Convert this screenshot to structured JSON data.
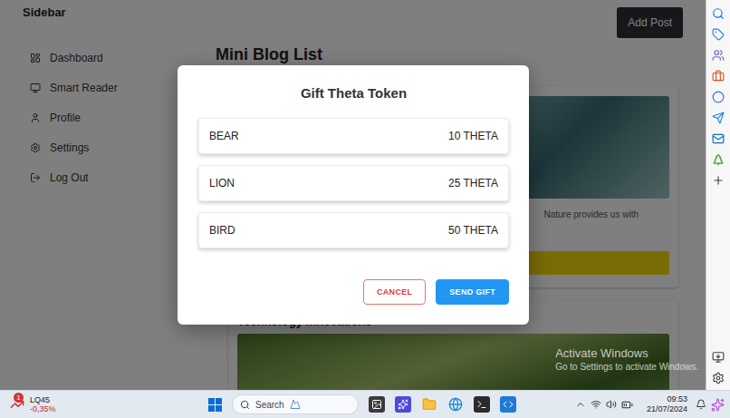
{
  "page": {
    "sidebar": {
      "title": "Sidebar",
      "items": [
        {
          "label": "Dashboard"
        },
        {
          "label": "Smart Reader"
        },
        {
          "label": "Profile"
        },
        {
          "label": "Settings"
        },
        {
          "label": "Log Out"
        }
      ]
    },
    "add_button": "Add Post",
    "heading": "Mini Blog List",
    "posts": [
      {
        "excerpt": "Nature provides us with"
      },
      {
        "title": "Technology Innovations"
      }
    ]
  },
  "dialog": {
    "title": "Gift Theta Token",
    "options": [
      {
        "name": "BEAR",
        "price": "10 THETA",
        "selected": false
      },
      {
        "name": "LION",
        "price": "25 THETA",
        "selected": false
      },
      {
        "name": "BIRD",
        "price": "50 THETA",
        "selected": false
      }
    ],
    "cancel": "CANCEL",
    "confirm": "SEND GIFT"
  },
  "watermark": {
    "title": "Activate Windows",
    "subtitle": "Go to Settings to activate Windows."
  },
  "taskbar": {
    "stock": {
      "symbol": "LQ45",
      "change": "-0,35%",
      "badge": "1"
    },
    "search": {
      "placeholder": "Search"
    },
    "clock": {
      "time": "09:53",
      "date": "21/07/2024"
    }
  }
}
